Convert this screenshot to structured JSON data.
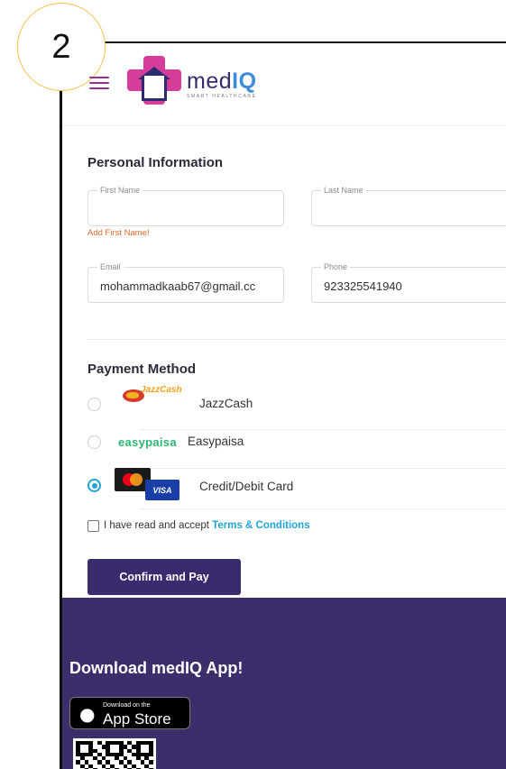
{
  "step_number": "2",
  "header": {
    "brand_name_prefix": "med",
    "brand_name_suffix": "IQ",
    "brand_tagline": "SMART HEALTHCARE",
    "menu_icon": "hamburger-menu-icon"
  },
  "personal": {
    "title": "Personal Information",
    "first_name": {
      "label": "First Name",
      "value": ""
    },
    "first_name_error": "Add First Name!",
    "last_name": {
      "label": "Last Name",
      "value": ""
    },
    "email": {
      "label": "Email",
      "value": "mohammadkaab67@gmail.cc"
    },
    "phone": {
      "label": "Phone",
      "value": "923325541940"
    }
  },
  "payment": {
    "title": "Payment Method",
    "methods": [
      {
        "label": "JazzCash",
        "logo_text": "JazzCash",
        "selected": false
      },
      {
        "label": "Easypaisa",
        "logo_text": "easypaisa",
        "selected": false
      },
      {
        "label": "Credit/Debit Card",
        "logo_text": "VISA",
        "selected": true
      }
    ]
  },
  "terms": {
    "prefix": "I have read and accept ",
    "link": "Terms & Conditions",
    "checked": false
  },
  "confirm_button": "Confirm and Pay",
  "footer": {
    "download_title": "Download medIQ App!",
    "appstore_small": "Download on the",
    "appstore_big": "App Store"
  },
  "colors": {
    "brand_purple": "#3a2a6e",
    "brand_pink": "#d43d9a",
    "accent_blue": "#21a4d8",
    "error_orange": "#e06a2b",
    "step_badge_border": "#f2c24c"
  }
}
